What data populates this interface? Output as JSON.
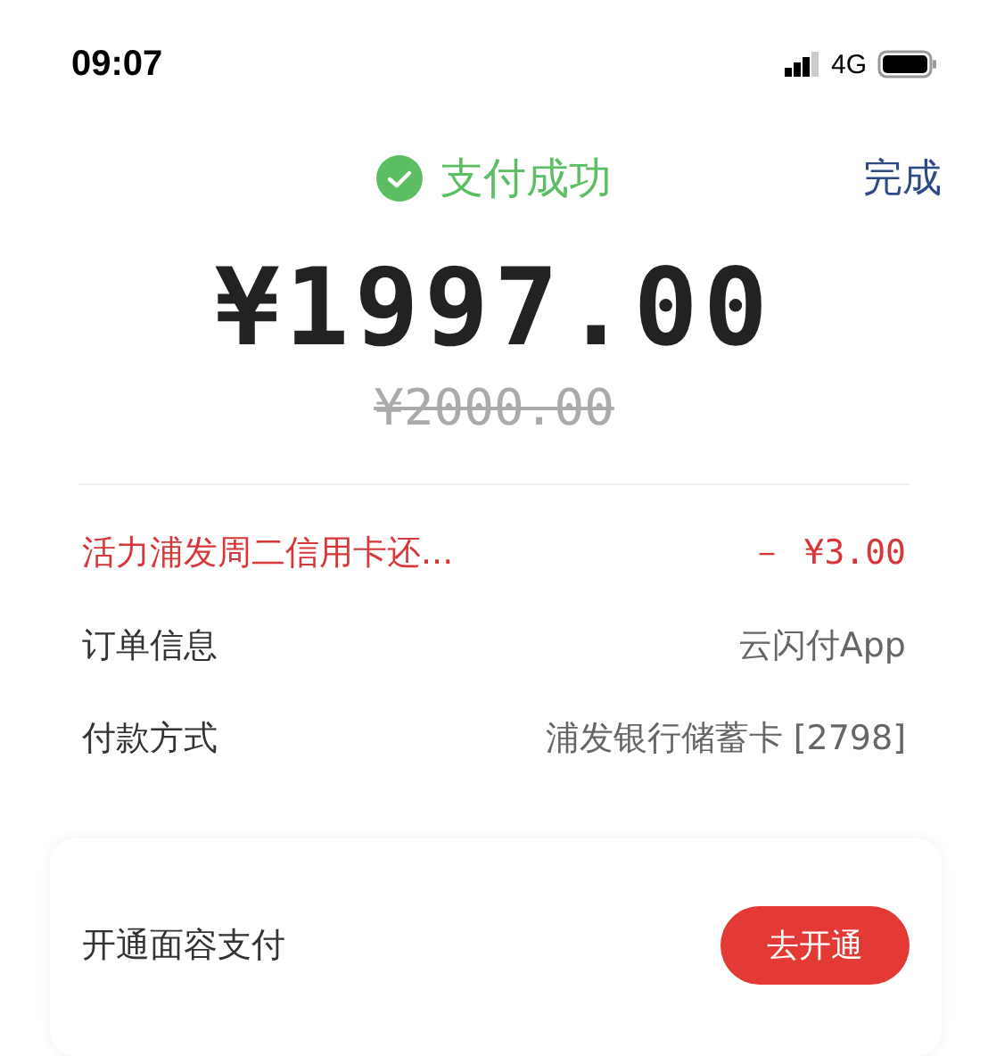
{
  "status_bar": {
    "time": "09:07",
    "network": "4G"
  },
  "header": {
    "title": "支付成功",
    "done": "完成"
  },
  "amount": "¥1997.00",
  "original_amount": "¥2000.00",
  "details": [
    {
      "kind": "discount",
      "label": "活力浦发周二信用卡还...",
      "value": "－ ¥3.00"
    },
    {
      "kind": "info",
      "label": "订单信息",
      "value": "云闪付App"
    },
    {
      "kind": "info",
      "label": "付款方式",
      "value": "浦发银行储蓄卡 [2798]"
    }
  ],
  "promo": {
    "label": "开通面容支付",
    "button": "去开通"
  }
}
